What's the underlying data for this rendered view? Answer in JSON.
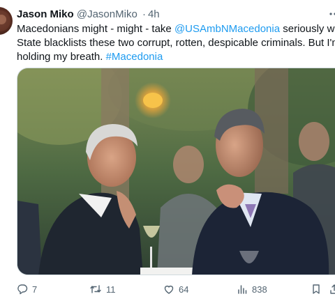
{
  "tweet": {
    "author_name": "Jason Miko",
    "author_handle": "@JasonMiko",
    "separator": "·",
    "time": "4h",
    "text": {
      "line1_prefix": "Macedonians might - might  - take ",
      "mention": "@USAmbNMacedonia",
      "line1_suffix": " seriously when",
      "line2": "State blacklists these two corrupt, rotten, despicable criminals.  But I'm not",
      "line3_prefix": "holding my breath. ",
      "hashtag": "#Macedonia"
    }
  },
  "actions": {
    "replies": "7",
    "reposts": "11",
    "likes": "64",
    "views": "838"
  },
  "icons": {
    "more": "more-horizontal-icon",
    "reply": "reply-icon",
    "repost": "repost-icon",
    "like": "heart-icon",
    "views": "views-bar-chart-icon",
    "bookmark": "bookmark-icon",
    "share": "share-icon"
  },
  "colors": {
    "link": "#1d9bf0",
    "secondary_text": "#536471",
    "primary_text": "#0f1419"
  }
}
